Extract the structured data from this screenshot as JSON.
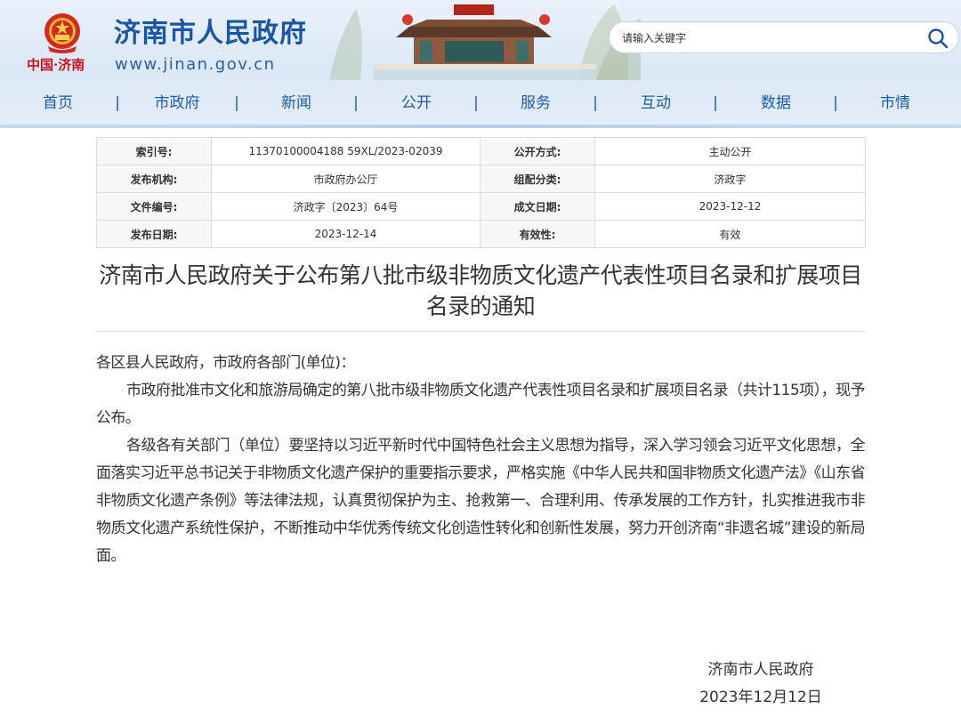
{
  "header": {
    "title": "济南市人民政府",
    "url": "www.jinan.gov.cn",
    "logo_text": "中国·济南",
    "emblem_icon": "national-emblem",
    "search": {
      "placeholder": "请输入关键字",
      "icon": "search-icon"
    },
    "colors": {
      "brand_blue": "#1a56a6",
      "logo_red": "#c8141e"
    }
  },
  "nav": {
    "items": [
      "首页",
      "市政府",
      "新闻",
      "公开",
      "服务",
      "互动",
      "数据",
      "市情"
    ],
    "separator": "|"
  },
  "meta": {
    "rows": [
      [
        "索引号:",
        "11370100004188 59XL/2023-02039",
        "公开方式:",
        "主动公开"
      ],
      [
        "发布机构:",
        "市政府办公厅",
        "组配分类:",
        "济政字"
      ],
      [
        "文件编号:",
        "济政字〔2023〕64号",
        "成文日期:",
        "2023-12-12"
      ],
      [
        "发布日期:",
        "2023-12-14",
        "有效性:",
        "有效"
      ]
    ]
  },
  "article": {
    "title": "济南市人民政府关于公布第八批市级非物质文化遗产代表性项目名录和扩展项目名录的通知",
    "salutation": "各区县人民政府，市政府各部门(单位)：",
    "paragraphs": [
      "市政府批准市文化和旅游局确定的第八批市级非物质文化遗产代表性项目名录和扩展项目名录（共计115项），现予公布。",
      "各级各有关部门（单位）要坚持以习近平新时代中国特色社会主义思想为指导，深入学习领会习近平文化思想，全面落实习近平总书记关于非物质文化遗产保护的重要指示要求，严格实施《中华人民共和国非物质文化遗产法》《山东省非物质文化遗产条例》等法律法规，认真贯彻保护为主、抢救第一、合理利用、传承发展的工作方针，扎实推进我市非物质文化遗产系统性保护，不断推动中华优秀传统文化创造性转化和创新性发展，努力开创济南“非遗名城”建设的新局面。"
    ],
    "signature": "济南市人民政府",
    "date": "2023年12月12日"
  }
}
